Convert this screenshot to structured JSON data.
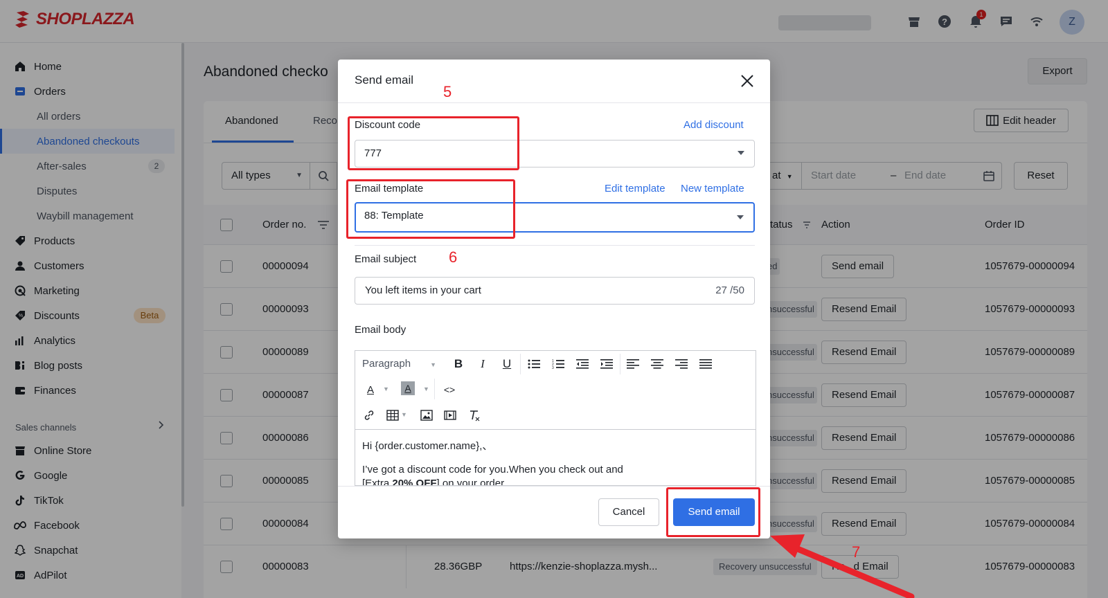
{
  "brand": {
    "name": "SHOPLAZZA",
    "color": "#d8262d"
  },
  "topbar": {
    "icons": [
      "store-icon",
      "help-icon",
      "bell-icon",
      "chat-icon",
      "wifi-icon"
    ],
    "notification_count": "1",
    "avatar_initial": "Z"
  },
  "sidebar": {
    "items": [
      {
        "label": "Home",
        "icon": "home-icon"
      },
      {
        "label": "Orders",
        "icon": "orders-icon"
      },
      {
        "label": "All orders"
      },
      {
        "label": "Abandoned checkouts",
        "active": true
      },
      {
        "label": "After-sales",
        "badge": "2"
      },
      {
        "label": "Disputes"
      },
      {
        "label": "Waybill management"
      },
      {
        "label": "Products",
        "icon": "tag-icon"
      },
      {
        "label": "Customers",
        "icon": "user-icon"
      },
      {
        "label": "Marketing",
        "icon": "megaphone-icon"
      },
      {
        "label": "Discounts",
        "icon": "discount-icon",
        "badge": "Beta"
      },
      {
        "label": "Analytics",
        "icon": "chart-icon"
      },
      {
        "label": "Blog posts",
        "icon": "blog-icon"
      },
      {
        "label": "Finances",
        "icon": "wallet-icon"
      }
    ],
    "section_label": "Sales channels",
    "channels": [
      {
        "label": "Online Store",
        "icon": "store-icon"
      },
      {
        "label": "Google",
        "icon": "google-icon"
      },
      {
        "label": "TikTok",
        "icon": "tiktok-icon"
      },
      {
        "label": "Facebook",
        "icon": "meta-icon"
      },
      {
        "label": "Snapchat",
        "icon": "snapchat-icon"
      },
      {
        "label": "AdPilot",
        "icon": "adpilot-icon"
      }
    ]
  },
  "page": {
    "title": "Abandoned checko",
    "export_label": "Export",
    "tabs": [
      "Abandoned",
      "Reco"
    ],
    "edit_header_label": "Edit header",
    "filter_type": "All types",
    "filter_status_partial": "at",
    "date_start": "Start date",
    "date_end": "End date",
    "reset_label": "Reset",
    "columns": {
      "order_no": "Order no.",
      "status": "tatus",
      "action": "Action",
      "order_id": "Order ID"
    },
    "rows": [
      {
        "order_no": "00000094",
        "status": "ed",
        "action": "Send email",
        "order_id": "1057679-00000094"
      },
      {
        "order_no": "00000093",
        "status": "nsuccessful",
        "action": "Resend Email",
        "order_id": "1057679-00000093"
      },
      {
        "order_no": "00000089",
        "status": "nsuccessful",
        "action": "Resend Email",
        "order_id": "1057679-00000089"
      },
      {
        "order_no": "00000087",
        "status": "nsuccessful",
        "action": "Resend Email",
        "order_id": "1057679-00000087"
      },
      {
        "order_no": "00000086",
        "status": "nsuccessful",
        "action": "Resend Email",
        "order_id": "1057679-00000086"
      },
      {
        "order_no": "00000085",
        "status": "nsuccessful",
        "action": "Resend Email",
        "order_id": "1057679-00000085"
      },
      {
        "order_no": "00000084",
        "status": "nsuccessful",
        "action": "Resend Email",
        "order_id": "1057679-00000084"
      },
      {
        "order_no": "00000083",
        "amount": "28.36GBP",
        "url": "https://kenzie-shoplazza.mysh...",
        "status": "Recovery unsuccessful",
        "action": "Re   d Email",
        "order_id": "1057679-00000083"
      }
    ]
  },
  "modal": {
    "title": "Send email",
    "discount": {
      "label": "Discount code",
      "link": "Add discount",
      "value": "777"
    },
    "template": {
      "label": "Email template",
      "edit_link": "Edit template",
      "new_link": "New template",
      "value": "88: Template"
    },
    "subject": {
      "label": "Email subject",
      "value": "You left items in your cart",
      "count": "27 /50"
    },
    "body": {
      "label": "Email body",
      "paragraph_select": "Paragraph",
      "line1": "Hi {order.customer.name},、",
      "line2": "I’ve got a discount code for you.When you check out and",
      "line3_start": "[Extra ",
      "line3_bold": "20% OFF",
      "line3_end": "] on your order"
    },
    "cancel_label": "Cancel",
    "send_label": "Send email"
  },
  "annotations": {
    "step5": "5",
    "step6": "6",
    "step7": "7",
    "color": "#e8232b"
  }
}
